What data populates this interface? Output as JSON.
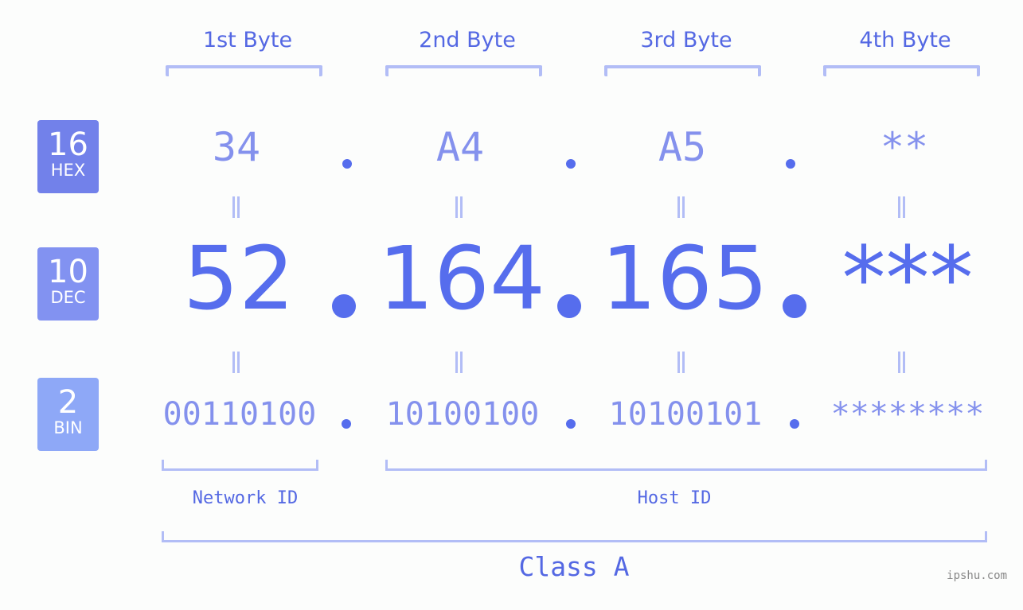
{
  "headers": [
    "1st Byte",
    "2nd Byte",
    "3rd Byte",
    "4th Byte"
  ],
  "badges": {
    "hex": {
      "num": "16",
      "label": "HEX",
      "color": "#7281ea"
    },
    "dec": {
      "num": "10",
      "label": "DEC",
      "color": "#8292f1"
    },
    "bin": {
      "num": "2",
      "label": "BIN",
      "color": "#8ea8f7"
    }
  },
  "hex": [
    "34",
    "A4",
    "A5",
    "**"
  ],
  "dec": [
    "52",
    "164",
    "165",
    "***"
  ],
  "bin": [
    "00110100",
    "10100100",
    "10100101",
    "********"
  ],
  "network_label": "Network ID",
  "host_label": "Host ID",
  "class_label": "Class A",
  "watermark": "ipshu.com",
  "colors": {
    "accent": "#566ded",
    "light": "#b2bdf6",
    "mid": "#8491ed"
  }
}
